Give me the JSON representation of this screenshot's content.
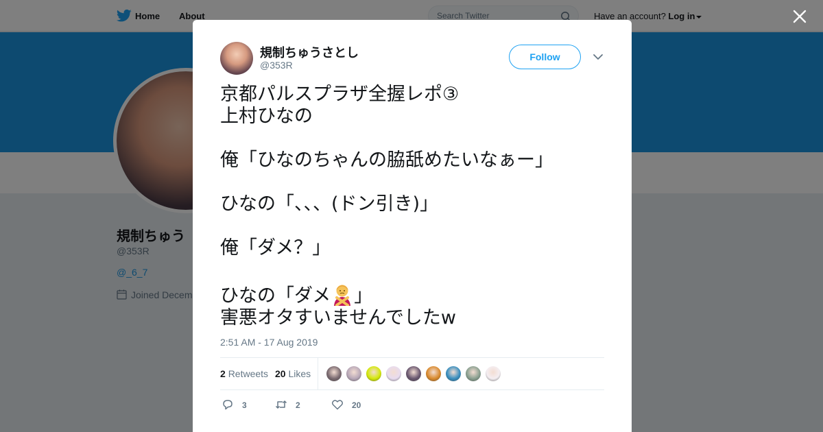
{
  "topbar": {
    "home_label": "Home",
    "about_label": "About",
    "search_placeholder": "Search Twitter",
    "account_prompt": "Have an account?",
    "login_label": "Log in"
  },
  "profile_bg": {
    "name": "規制ちゅう",
    "handle": "@353R",
    "link": "@_6_7",
    "joined": "Joined Decem"
  },
  "tweet": {
    "author_name": "規制ちゅうさとし",
    "author_handle": "@353R",
    "follow_label": "Follow",
    "text_body": "京都パルスプラザ全握レポ③\n上村ひなの\n\n俺「ひなのちゃんの脇舐めたいなぁー」\n\nひなの「、、、(ドン引き)」\n\n俺「ダメ？」\n",
    "text_line_emoji_before": "ひなの「ダメ",
    "text_line_emoji_after": "」",
    "text_last_line": "害悪オタすいませんでしたw",
    "emoji_icon": "woman-gesturing-no-icon",
    "timestamp": "2:51 AM - 17 Aug 2019",
    "retweets_count": "2",
    "retweets_label": "Retweets",
    "likes_count": "20",
    "likes_label": "Likes",
    "liker_avatar_colors": [
      "#7a6a70",
      "#b8a8b8",
      "#d4e80c",
      "#e8dcef",
      "#6a5870",
      "#d98a2e",
      "#3a8fbf",
      "#8aa090",
      "#f4eef2"
    ],
    "reply_count": "3",
    "retweet_count": "2",
    "like_count": "20"
  },
  "colors": {
    "accent": "#1da1f2",
    "banner": "#1b95e0",
    "text_secondary": "#657786"
  }
}
